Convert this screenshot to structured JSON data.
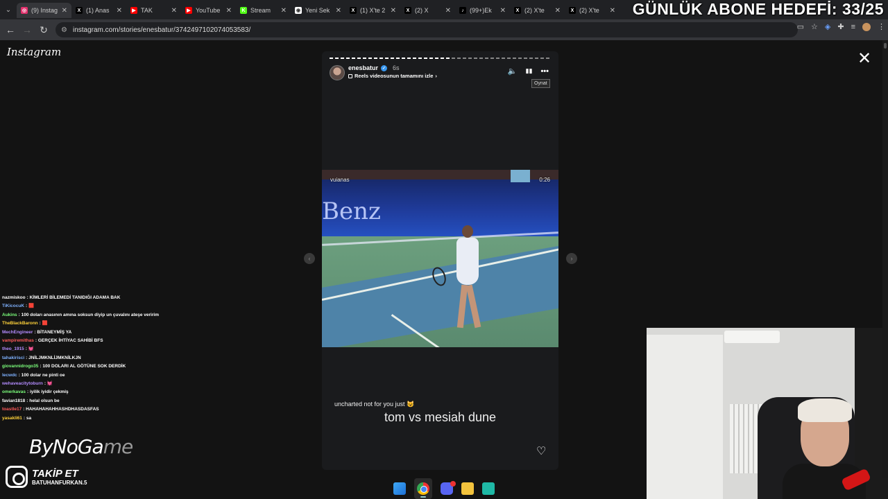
{
  "browser": {
    "tabs": [
      {
        "label": "(9) Instag",
        "fav_color": "#e1306c",
        "fav_glyph": "◎",
        "active": true
      },
      {
        "label": "(1) Anas",
        "fav_color": "#000000",
        "fav_glyph": "X",
        "active": false
      },
      {
        "label": "TAK",
        "fav_color": "#ff0000",
        "fav_glyph": "▶",
        "active": false
      },
      {
        "label": "YouTube",
        "fav_color": "#ff0000",
        "fav_glyph": "▶",
        "active": false
      },
      {
        "label": "Stream",
        "fav_color": "#53fc18",
        "fav_glyph": "K",
        "active": false
      },
      {
        "label": "Yeni Sek",
        "fav_color": "#ffffff",
        "fav_glyph": "◉",
        "active": false
      },
      {
        "label": "(1) X'te 2",
        "fav_color": "#000000",
        "fav_glyph": "X",
        "active": false
      },
      {
        "label": "(2) X",
        "fav_color": "#000000",
        "fav_glyph": "X",
        "active": false
      },
      {
        "label": "(99+)Ek",
        "fav_color": "#000000",
        "fav_glyph": "♪",
        "active": false
      },
      {
        "label": "(2) X'te",
        "fav_color": "#000000",
        "fav_glyph": "X",
        "active": false
      },
      {
        "label": "(2) X'te",
        "fav_color": "#000000",
        "fav_glyph": "X",
        "active": false
      }
    ],
    "url": "instagram.com/stories/enesbatur/3742497102074053583/"
  },
  "overlay": {
    "title": "GÜNLÜK ABONE HEDEFİ: 33/25"
  },
  "instagram": {
    "logo": "Instagram",
    "story": {
      "username": "enesbatur",
      "time": "6s",
      "reels_link": "Reels videosunun tamamını izle",
      "tooltip": "Oynat",
      "progress": 0.55,
      "video": {
        "handle": "vuianas",
        "duration": "0:26",
        "sponsor_text": "Benz"
      },
      "caption_small": "uncharted not for you just 😺",
      "caption_big": "tom vs mesiah dune"
    }
  },
  "chat": [
    {
      "user": "nazmiskoo",
      "color": "#ffffff",
      "msg": "KİMLERİ BİLEMEDİ TANIDIĞI ADAMA BAK"
    },
    {
      "user": "TiKicocuK",
      "color": "#7fb2ff",
      "msg": "🟥"
    },
    {
      "user": "Aukins",
      "color": "#7cff7c",
      "msg": "100 doları anasının amına soksun diyip un çuvalını ateşe veririm"
    },
    {
      "user": "TheBlackBaronn",
      "color": "#ffd23a",
      "msg": "🟥"
    },
    {
      "user": "MechEngineer",
      "color": "#b48cff",
      "msg": "BİTANEYMİŞ YA"
    },
    {
      "user": "vampiremithas",
      "color": "#ff5a5a",
      "msg": "GERÇEK İHTİYAC SAHİBİ BFS"
    },
    {
      "user": "theo_1915",
      "color": "#b48cff",
      "msg": "💓"
    },
    {
      "user": "tahakirisci",
      "color": "#7fb2ff",
      "msg": "JNİLJMKNLİJMKNİLKJN"
    },
    {
      "user": "giovannidrogo35",
      "color": "#7cff7c",
      "msg": "100 DOLARI AL GÖTÜNE SOK DERDİK"
    },
    {
      "user": "lecwdc",
      "color": "#7fb2ff",
      "msg": "100 dolar ne pinti oe"
    },
    {
      "user": "wehaveacitytoburn",
      "color": "#b48cff",
      "msg": "💓"
    },
    {
      "user": "omerkavas",
      "color": "#7cff7c",
      "msg": "iyilik iyidir çekmiş"
    },
    {
      "user": "favian1818",
      "color": "#ffffff",
      "msg": "helal olsun be"
    },
    {
      "user": "toastle17",
      "color": "#ff5a5a",
      "msg": "HAHAHAHAHHASHDHASDASFAS"
    },
    {
      "user": "yasakli61",
      "color": "#ffd23a",
      "msg": "sa"
    }
  ],
  "branding": {
    "name_main": "ByNoGa",
    "name_tail": "me",
    "follow": "TAKİP ET",
    "handle": "BATUHANFURKAN.5"
  },
  "taskbar": [
    "windows",
    "chrome",
    "discord",
    "explorer",
    "app"
  ]
}
